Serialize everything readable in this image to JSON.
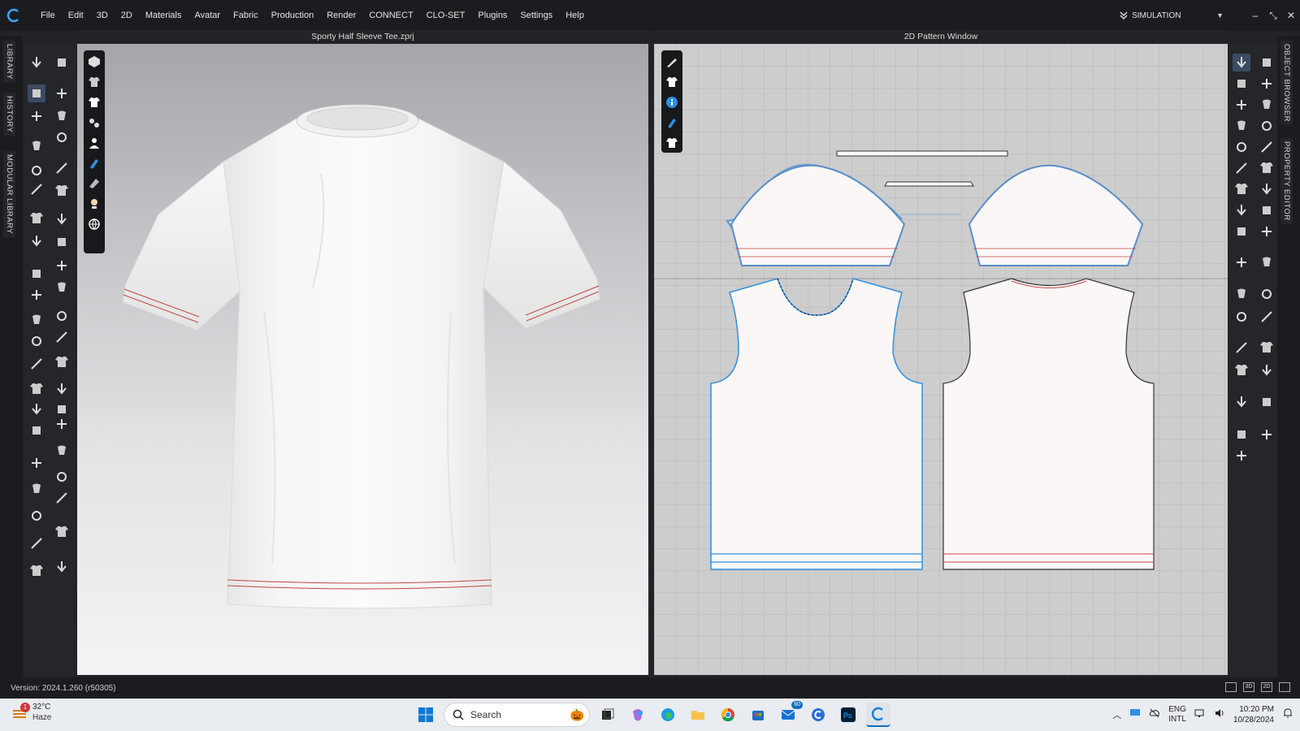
{
  "menubar": {
    "items": [
      "File",
      "Edit",
      "3D",
      "2D",
      "Materials",
      "Avatar",
      "Fabric",
      "Production",
      "Render",
      "CONNECT",
      "CLO-SET",
      "Plugins",
      "Settings",
      "Help"
    ],
    "simulation_label": "SIMULATION"
  },
  "side_tabs_left": [
    "LIBRARY",
    "HISTORY",
    "MODULAR LIBRARY"
  ],
  "side_tabs_right": [
    "OBJECT BROWSER",
    "PROPERTY EDITOR"
  ],
  "window_3d": {
    "title": "Sporty Half Sleeve Tee.zprj"
  },
  "window_2d": {
    "title": "2D Pattern Window"
  },
  "statusbar": {
    "version": "Version: 2024.1.260 (r50305)",
    "view_modes": [
      "",
      "3D",
      "2D",
      ""
    ]
  },
  "taskbar": {
    "weather_temp": "32°C",
    "weather_desc": "Haze",
    "weather_badge": "1",
    "search_placeholder": "Search",
    "mail_badge": "60",
    "lang_top": "ENG",
    "lang_bottom": "INTL",
    "time": "10:20 PM",
    "date": "10/28/2024"
  },
  "colors": {
    "accent": "#2f8fe0",
    "seam_red": "#c0463f",
    "taskbar_bg": "#e9ecf1"
  }
}
